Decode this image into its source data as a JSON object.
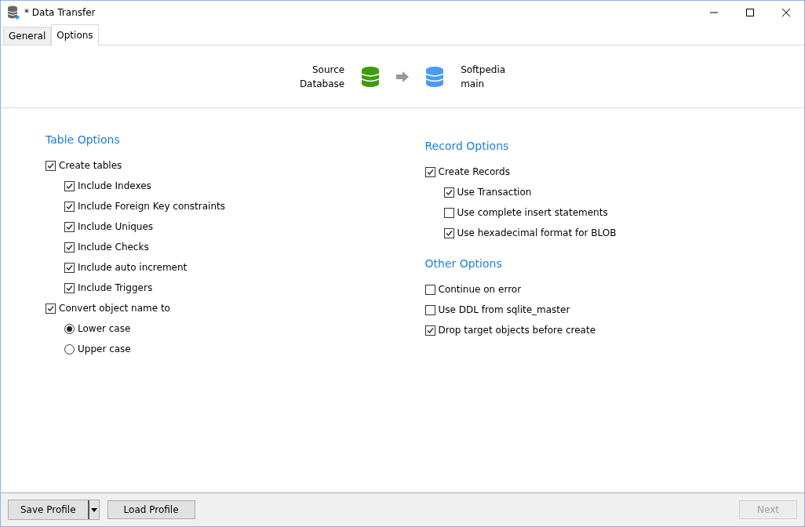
{
  "window": {
    "title": "* Data Transfer"
  },
  "tabs": [
    {
      "label": "General",
      "selected": false
    },
    {
      "label": "Options",
      "selected": true
    }
  ],
  "transfer": {
    "source": [
      "Source",
      "Database"
    ],
    "target": [
      "Softpedia",
      "main"
    ]
  },
  "columns": [
    {
      "groups": [
        {
          "heading": "Table Options",
          "items": [
            {
              "kind": "checkbox",
              "label": "Create tables",
              "checked": true,
              "children": [
                {
                  "kind": "checkbox",
                  "label": "Include Indexes",
                  "checked": true
                },
                {
                  "kind": "checkbox",
                  "label": "Include Foreign Key constraints",
                  "checked": true
                },
                {
                  "kind": "checkbox",
                  "label": "Include Uniques",
                  "checked": true
                },
                {
                  "kind": "checkbox",
                  "label": "Include Checks",
                  "checked": true
                },
                {
                  "kind": "checkbox",
                  "label": "Include auto increment",
                  "checked": true
                },
                {
                  "kind": "checkbox",
                  "label": "Include Triggers",
                  "checked": true
                }
              ]
            },
            {
              "kind": "checkbox",
              "label": "Convert object name to",
              "checked": true,
              "children": [
                {
                  "kind": "radio",
                  "label": "Lower case",
                  "selected": true
                },
                {
                  "kind": "radio",
                  "label": "Upper case",
                  "selected": false
                }
              ]
            }
          ]
        }
      ]
    },
    {
      "groups": [
        {
          "heading": "Record Options",
          "items": [
            {
              "kind": "checkbox",
              "label": "Create Records",
              "checked": true,
              "children": [
                {
                  "kind": "checkbox",
                  "label": "Use Transaction",
                  "checked": true
                },
                {
                  "kind": "checkbox",
                  "label": "Use complete insert statements",
                  "checked": false
                },
                {
                  "kind": "checkbox",
                  "label": "Use hexadecimal format for BLOB",
                  "checked": true
                }
              ]
            }
          ]
        },
        {
          "heading": "Other Options",
          "items": [
            {
              "kind": "checkbox",
              "label": "Continue on error",
              "checked": false
            },
            {
              "kind": "checkbox",
              "label": "Use DDL from sqlite_master",
              "checked": false
            },
            {
              "kind": "checkbox",
              "label": "Drop target objects before create",
              "checked": true
            }
          ]
        }
      ]
    }
  ],
  "footer": {
    "save_button": "Save Profile",
    "load_button": "Load Profile",
    "next_button": {
      "label": "Next",
      "disabled": true
    }
  }
}
